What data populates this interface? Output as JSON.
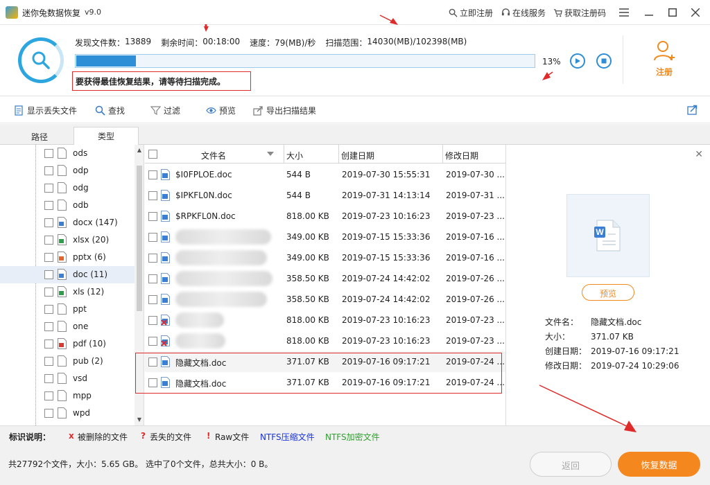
{
  "app": {
    "title": "迷你兔数据恢复",
    "version": "v9.0",
    "links": {
      "register_now": "立即注册",
      "online_service": "在线服务",
      "get_code": "获取注册码"
    }
  },
  "scan": {
    "found_label": "发现文件数：",
    "found_value": "13889",
    "remaining_label": "剩余时间：",
    "remaining_value": "00:18:00",
    "speed_label": "速度：",
    "speed_value": "79(MB)/秒",
    "range_label": "扫描范围：",
    "range_value": "14030(MB)/102398(MB)",
    "progress_percent": 13,
    "progress_text": "13%",
    "hint": "要获得最佳恢复结果，请等待扫描完成。"
  },
  "register": {
    "label": "注册"
  },
  "toolbar": {
    "show_lost": "显示丢失文件",
    "find": "查找",
    "filter": "过滤",
    "preview": "预览",
    "export": "导出扫描结果"
  },
  "tabs": {
    "path": "路径",
    "type": "类型"
  },
  "tree": [
    {
      "label": "ods",
      "icon": "file-icon"
    },
    {
      "label": "odp",
      "icon": "file-icon"
    },
    {
      "label": "odg",
      "icon": "file-icon"
    },
    {
      "label": "odb",
      "icon": "file-icon"
    },
    {
      "label": "docx (147)",
      "icon": "word-icon"
    },
    {
      "label": "xlsx (20)",
      "icon": "excel-icon"
    },
    {
      "label": "pptx (6)",
      "icon": "ppt-icon"
    },
    {
      "label": "doc (11)",
      "icon": "word-icon"
    },
    {
      "label": "xls (12)",
      "icon": "excel-icon"
    },
    {
      "label": "ppt",
      "icon": "file-icon"
    },
    {
      "label": "one",
      "icon": "file-icon"
    },
    {
      "label": "pdf (10)",
      "icon": "pdf-icon"
    },
    {
      "label": "pub (2)",
      "icon": "file-icon"
    },
    {
      "label": "vsd",
      "icon": "file-icon"
    },
    {
      "label": "mpp",
      "icon": "file-icon"
    },
    {
      "label": "wpd",
      "icon": "file-icon"
    }
  ],
  "table": {
    "headers": {
      "name": "文件名",
      "size": "大小",
      "created": "创建日期",
      "modified": "修改日期"
    },
    "rows": [
      {
        "name": "$I0FPLOE.doc",
        "size": "544 B",
        "created": "2019-07-30 15:55:31",
        "modified": "2019-07-30 ...",
        "deleted": false
      },
      {
        "name": "$IPKFL0N.doc",
        "size": "544 B",
        "created": "2019-07-31 14:13:14",
        "modified": "2019-07-31 ...",
        "deleted": false
      },
      {
        "name": "$RPKFL0N.doc",
        "size": "818.00 KB",
        "created": "2019-07-23 10:16:23",
        "modified": "2019-07-23 ...",
        "deleted": false
      },
      {
        "name": "",
        "size": "349.00 KB",
        "created": "2019-07-15 15:33:36",
        "modified": "2019-07-16 ...",
        "deleted": false
      },
      {
        "name": "",
        "size": "349.00 KB",
        "created": "2019-07-15 15:33:36",
        "modified": "2019-07-16 ...",
        "deleted": false
      },
      {
        "name": "",
        "size": "358.50 KB",
        "created": "2019-07-24 14:42:02",
        "modified": "2019-07-26 ...",
        "deleted": false
      },
      {
        "name": "",
        "size": "358.50 KB",
        "created": "2019-07-24 14:42:02",
        "modified": "2019-07-26 ...",
        "deleted": false
      },
      {
        "name": "",
        "size": "818.00 KB",
        "created": "2019-07-23 10:16:23",
        "modified": "2019-07-23 ...",
        "deleted": true
      },
      {
        "name": "",
        "size": "818.00 KB",
        "created": "2019-07-23 10:16:23",
        "modified": "2019-07-23 ...",
        "deleted": true
      },
      {
        "name": "隐藏文档.doc",
        "size": "371.07 KB",
        "created": "2019-07-16 09:17:21",
        "modified": "2019-07-24 ...",
        "deleted": false
      },
      {
        "name": "隐藏文档.doc",
        "size": "371.07 KB",
        "created": "2019-07-16 09:17:21",
        "modified": "2019-07-24 ...",
        "deleted": false
      }
    ]
  },
  "preview": {
    "button": "预览",
    "name_label": "文件名：",
    "name_value": "隐藏文档.doc",
    "size_label": "大小：",
    "size_value": "371.07 KB",
    "created_label": "创建日期：",
    "created_value": "2019-07-16 09:17:21",
    "modified_label": "修改日期：",
    "modified_value": "2019-07-24 10:29:06"
  },
  "legend": {
    "title": "标识说明：",
    "deleted_mark": "x",
    "deleted": "被删除的文件",
    "lost_mark": "?",
    "lost": "丢失的文件",
    "raw_mark": "!",
    "raw": "Raw文件",
    "ntfs_compressed": "NTFS压缩文件",
    "ntfs_encrypted": "NTFS加密文件"
  },
  "status": {
    "summary": "共27792个文件，大小：5.65 GB。 选中了0个文件，总共大小：0 B。"
  },
  "buttons": {
    "back": "返回",
    "recover": "恢复数据"
  },
  "colors": {
    "accent_blue": "#2e8fd6",
    "accent_orange": "#f5871f",
    "annotation_red": "#e02a2a",
    "ntfs_compressed": "#1a33d6",
    "ntfs_encrypted": "#2e9e2e"
  }
}
